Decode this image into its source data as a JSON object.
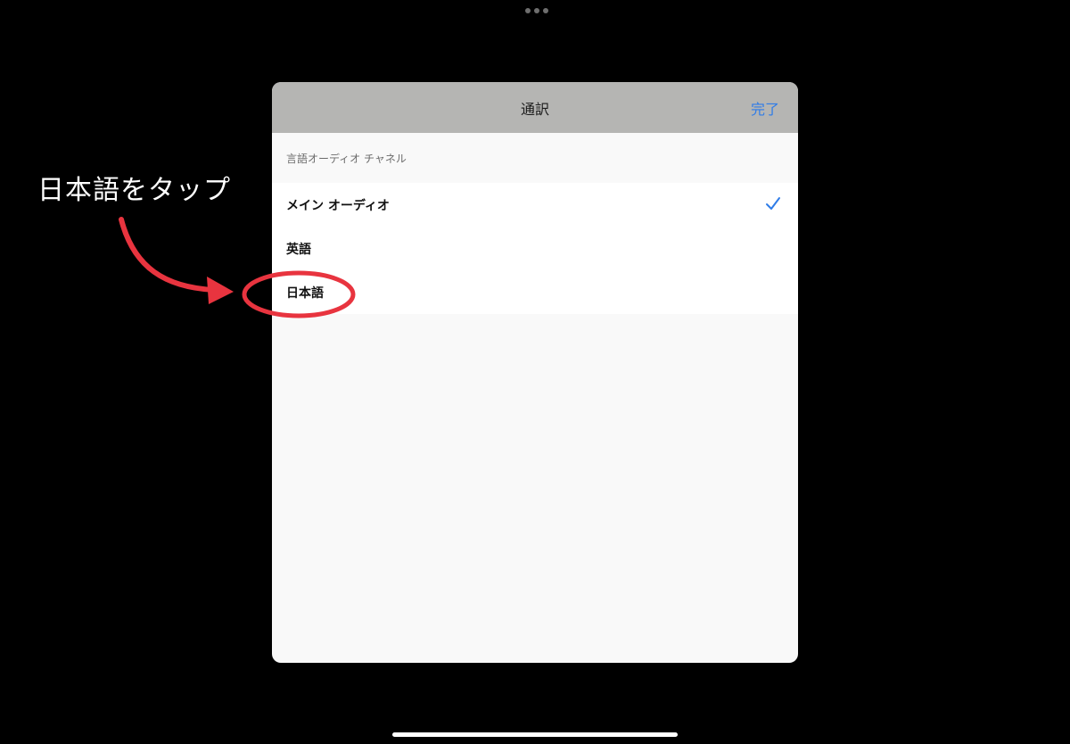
{
  "sheet": {
    "title": "通訳",
    "done_label": "完了",
    "section_header": "言語オーディオ チャネル",
    "items": [
      {
        "label": "メイン オーディオ",
        "selected": true
      },
      {
        "label": "英語",
        "selected": false
      },
      {
        "label": "日本語",
        "selected": false
      }
    ]
  },
  "annotation": {
    "text": "日本語をタップ",
    "color": "#e8343f"
  },
  "colors": {
    "accent": "#2f7ce8",
    "nav_bar": "#b5b5b3",
    "background": "#000000"
  }
}
